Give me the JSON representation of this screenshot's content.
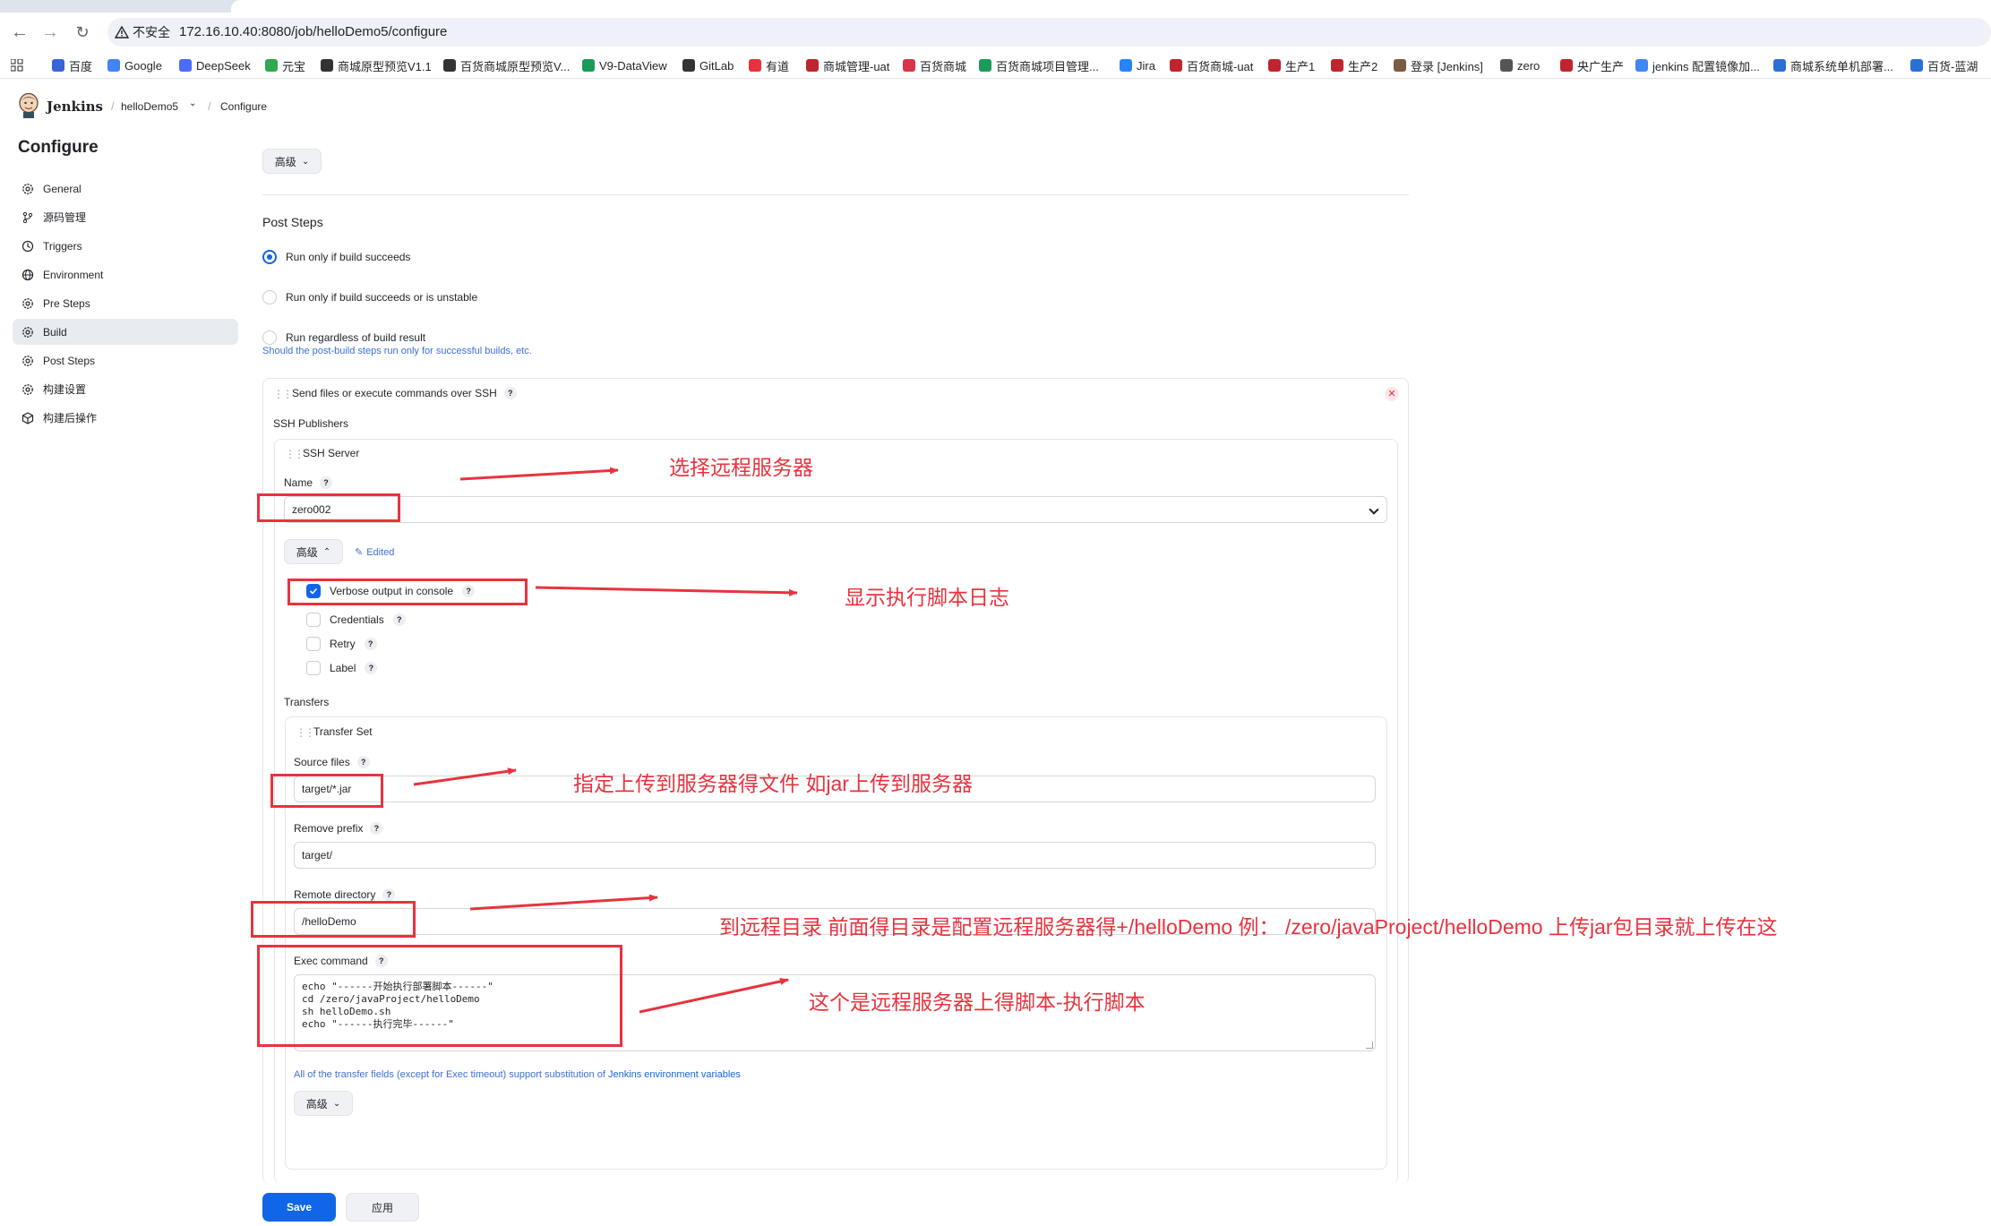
{
  "browser": {
    "security_label": "不安全",
    "url": "172.16.10.40:8080/job/helloDemo5/configure",
    "bookmarks": [
      {
        "label": "百度",
        "color": "#3a63d8"
      },
      {
        "label": "Google",
        "color": "#4285f4"
      },
      {
        "label": "DeepSeek",
        "color": "#4d6bfe"
      },
      {
        "label": "元宝",
        "color": "#2fa84f"
      },
      {
        "label": "商城原型预览V1.1",
        "color": "#333333"
      },
      {
        "label": "百货商城原型预览V...",
        "color": "#333333"
      },
      {
        "label": "V9-DataView",
        "color": "#1a9b5a"
      },
      {
        "label": "GitLab",
        "color": "#333333"
      },
      {
        "label": "有道",
        "color": "#e8333e"
      },
      {
        "label": "商城管理-uat",
        "color": "#c0242e"
      },
      {
        "label": "百货商城",
        "color": "#d8344a"
      },
      {
        "label": "百货商城项目管理...",
        "color": "#1a9b5a"
      },
      {
        "label": "Jira",
        "color": "#2684ff"
      },
      {
        "label": "百货商城-uat",
        "color": "#c0242e"
      },
      {
        "label": "生产1",
        "color": "#c0242e"
      },
      {
        "label": "生产2",
        "color": "#c0242e"
      },
      {
        "label": "登录 [Jenkins]",
        "color": "#7a5b44"
      },
      {
        "label": "zero",
        "color": "#555555"
      },
      {
        "label": "央广生产",
        "color": "#c0242e"
      },
      {
        "label": "jenkins 配置镜像加...",
        "color": "#4285f4"
      },
      {
        "label": "商城系统单机部署...",
        "color": "#2b6fd6"
      },
      {
        "label": "百货-蓝湖",
        "color": "#2b6fd6"
      }
    ]
  },
  "header": {
    "brand": "Jenkins",
    "breadcrumbs": [
      "helloDemo5",
      "Configure"
    ]
  },
  "sidebar": {
    "title": "Configure",
    "items": [
      {
        "label": "General",
        "icon": "gear-icon"
      },
      {
        "label": "源码管理",
        "icon": "branch-icon"
      },
      {
        "label": "Triggers",
        "icon": "clock-icon"
      },
      {
        "label": "Environment",
        "icon": "globe-icon"
      },
      {
        "label": "Pre Steps",
        "icon": "gear-icon"
      },
      {
        "label": "Build",
        "icon": "gear-icon"
      },
      {
        "label": "Post Steps",
        "icon": "gear-icon"
      },
      {
        "label": "构建设置",
        "icon": "gear-icon"
      },
      {
        "label": "构建后操作",
        "icon": "cube-icon"
      }
    ],
    "active": "Build"
  },
  "main": {
    "advanced_label": "高级",
    "post_steps_title": "Post Steps",
    "post_steps_options": [
      {
        "label": "Run only if build succeeds",
        "selected": true
      },
      {
        "label": "Run only if build succeeds or is unstable",
        "selected": false
      },
      {
        "label": "Run regardless of build result",
        "selected": false
      }
    ],
    "post_steps_help": "Should the post-build steps run only for successful builds, etc.",
    "ssh_block_title": "Send files or execute commands over SSH",
    "ssh_publishers_label": "SSH Publishers",
    "ssh_server_label": "SSH Server",
    "name_label": "Name",
    "name_value": "zero002",
    "server_advanced_label": "高级",
    "edited_label": "Edited",
    "server_checks": [
      {
        "label": "Verbose output in console",
        "checked": true
      },
      {
        "label": "Credentials",
        "checked": false
      },
      {
        "label": "Retry",
        "checked": false
      },
      {
        "label": "Label",
        "checked": false
      }
    ],
    "transfers_label": "Transfers",
    "transfer_set_label": "Transfer Set",
    "source_files_label": "Source files",
    "source_files_value": "target/*.jar",
    "remove_prefix_label": "Remove prefix",
    "remove_prefix_value": "target/",
    "remote_dir_label": "Remote directory",
    "remote_dir_value": "/helloDemo",
    "exec_label": "Exec command",
    "exec_value": "echo \"------开始执行部署脚本------\"\ncd /zero/javaProject/helloDemo\nsh helloDemo.sh\necho \"------执行完毕------\"",
    "info_prefix": "All of the transfer fields (except for Exec timeout) support substitution of ",
    "info_link": "Jenkins environment variables",
    "transfer_advanced_label": "高级",
    "save_label": "Save",
    "apply_label": "应用"
  },
  "annotations": {
    "select_server": "选择远程服务器",
    "verbose_log": "显示执行脚本日志",
    "source_files": "指定上传到服务器得文件 如jar上传到服务器",
    "remote_dir": "到远程目录 前面得目录是配置远程服务器得+/helloDemo 例： /zero/javaProject/helloDemo  上传jar包目录就上传在这",
    "exec_command": "这个是远程服务器上得脚本-执行脚本",
    "color": "#e8333e"
  }
}
